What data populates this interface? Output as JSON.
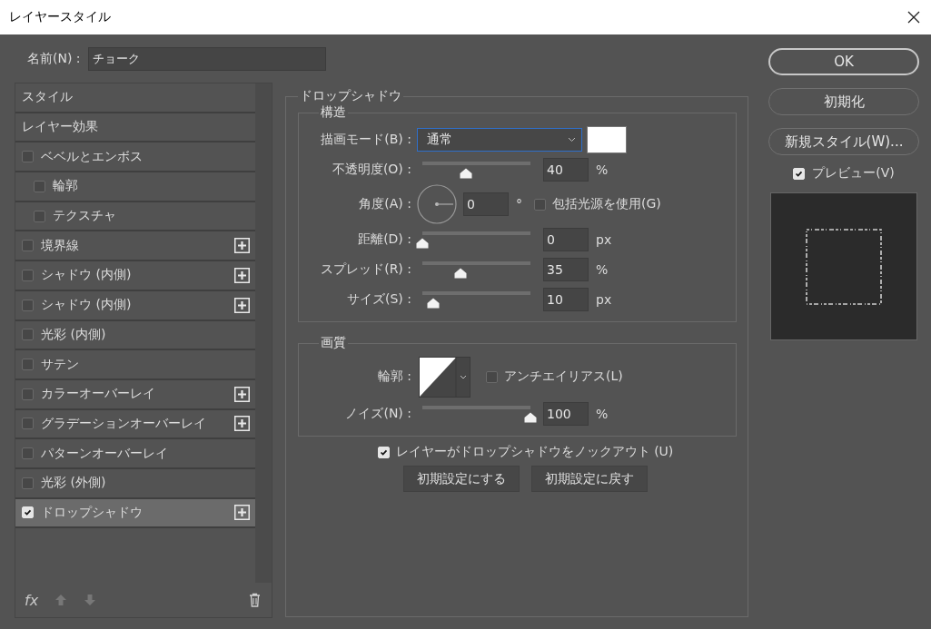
{
  "window": {
    "title": "レイヤースタイル"
  },
  "name_field": {
    "label": "名前(N) :",
    "value": "チョーク"
  },
  "style_list": {
    "items": [
      {
        "label": "スタイル",
        "kind": "header",
        "selected": false
      },
      {
        "label": "レイヤー効果",
        "kind": "header",
        "selected": false
      },
      {
        "label": "ベベルとエンボス",
        "kind": "effect",
        "checked": false,
        "selected": false,
        "addable": false,
        "children": [
          {
            "label": "輪郭",
            "kind": "effect",
            "checked": false,
            "selected": false,
            "addable": false
          },
          {
            "label": "テクスチャ",
            "kind": "effect",
            "checked": false,
            "selected": false,
            "addable": false
          }
        ]
      },
      {
        "label": "境界線",
        "kind": "effect",
        "checked": false,
        "selected": false,
        "addable": true
      },
      {
        "label": "シャドウ (内側)",
        "kind": "effect",
        "checked": false,
        "selected": false,
        "addable": true
      },
      {
        "label": "シャドウ (内側)",
        "kind": "effect",
        "checked": false,
        "selected": false,
        "addable": true
      },
      {
        "label": "光彩 (内側)",
        "kind": "effect",
        "checked": false,
        "selected": false,
        "addable": false
      },
      {
        "label": "サテン",
        "kind": "effect",
        "checked": false,
        "selected": false,
        "addable": false
      },
      {
        "label": "カラーオーバーレイ",
        "kind": "effect",
        "checked": false,
        "selected": false,
        "addable": true
      },
      {
        "label": "グラデーションオーバーレイ",
        "kind": "effect",
        "checked": false,
        "selected": false,
        "addable": true
      },
      {
        "label": "パターンオーバーレイ",
        "kind": "effect",
        "checked": false,
        "selected": false,
        "addable": false
      },
      {
        "label": "光彩 (外側)",
        "kind": "effect",
        "checked": false,
        "selected": false,
        "addable": false
      },
      {
        "label": "ドロップシャドウ",
        "kind": "effect",
        "checked": true,
        "selected": true,
        "addable": true
      }
    ]
  },
  "toolbar": {
    "fx": "fx"
  },
  "settings": {
    "title": "ドロップシャドウ",
    "structure": {
      "title": "構造",
      "controls": [
        {
          "kind": "blend",
          "label": "描画モード(B) :",
          "value": "通常",
          "color": "#ffffff"
        },
        {
          "kind": "slider",
          "label": "不透明度(O) :",
          "level": 0.4,
          "value": "40",
          "unit": "%"
        },
        {
          "kind": "angle",
          "label": "角度(A) :",
          "value": "0",
          "unit": "°",
          "option": {
            "label": "包括光源を使用(G)",
            "checked": false
          }
        },
        {
          "kind": "slider",
          "label": "距離(D) :",
          "level": 0,
          "value": "0",
          "unit": "px"
        },
        {
          "kind": "slider",
          "label": "スプレッド(R) :",
          "level": 0.35,
          "value": "35",
          "unit": "%"
        },
        {
          "kind": "slider",
          "label": "サイズ(S) :",
          "level": 0.1,
          "value": "10",
          "unit": "px"
        }
      ]
    },
    "quality": {
      "title": "画質",
      "controls": [
        {
          "kind": "contour",
          "label": "輪郭 :",
          "option": {
            "label": "アンチエイリアス(L)",
            "checked": false
          }
        },
        {
          "kind": "slider",
          "label": "ノイズ(N) :",
          "level": 1,
          "value": "100",
          "unit": "%"
        }
      ]
    },
    "knockout": {
      "label": "レイヤーがドロップシャドウをノックアウト (U)",
      "checked": true
    },
    "buttons": [
      "初期設定にする",
      "初期設定に戻す"
    ]
  },
  "side": {
    "buttons": [
      {
        "label": "OK",
        "kind": "default"
      },
      {
        "label": "初期化",
        "kind": "normal"
      },
      {
        "label": "新規スタイル(W)...",
        "kind": "normal"
      }
    ],
    "preview": {
      "label": "プレビュー(V)",
      "checked": true
    }
  }
}
